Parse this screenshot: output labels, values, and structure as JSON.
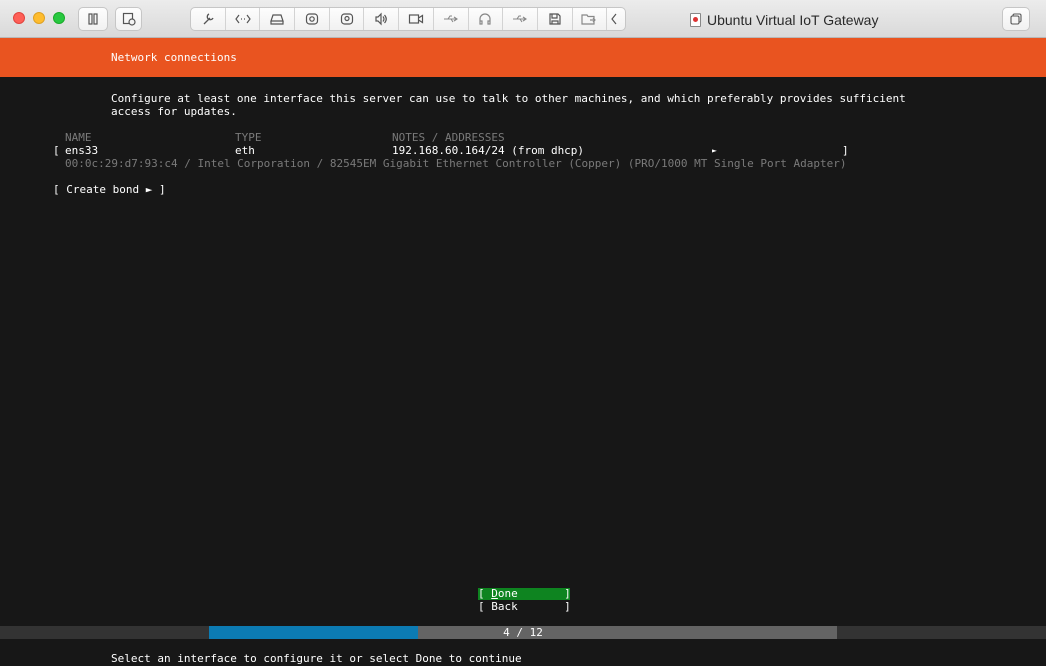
{
  "window": {
    "title": "Ubuntu Virtual IoT Gateway",
    "toolbar_icons": [
      "wrench-icon",
      "code-brackets-icon",
      "hard-drive-icon",
      "camera-icon",
      "webcam-icon",
      "speaker-icon",
      "video-icon",
      "usb-icon",
      "headphones-icon",
      "usb-icon",
      "floppy-icon",
      "shared-folder-icon",
      "chevron-left-icon"
    ]
  },
  "installer": {
    "header_title": "Network connections",
    "description_line1": "Configure at least one interface this server can use to talk to other machines, and which preferably provides sufficient",
    "description_line2": "access for updates.",
    "columns": {
      "name": "NAME",
      "type": "TYPE",
      "notes": "NOTES / ADDRESSES"
    },
    "interface": {
      "open_bracket": "[",
      "name": "ens33",
      "type": "eth",
      "address": "192.168.60.164/24 (from dhcp)",
      "arrow": "►",
      "close_bracket": "]",
      "details": "00:0c:29:d7:93:c4 / Intel Corporation / 82545EM Gigabit Ethernet Controller (Copper) (PRO/1000 MT Single Port Adapter)"
    },
    "create_bond": "[ Create bond ► ]",
    "buttons": {
      "done_open": "[ ",
      "done_hotkey": "D",
      "done_rest": "one       ]",
      "back": "[ Back       ]"
    },
    "progress": {
      "label": "4 / 12",
      "current": 4,
      "total": 12,
      "fraction": 0.333
    },
    "status_text": "Select an interface to configure it or select Done to continue"
  },
  "colors": {
    "accent": "#e95420",
    "done_bg": "#0e8420",
    "progress_fill": "#0c7bb3",
    "background": "#171717"
  }
}
